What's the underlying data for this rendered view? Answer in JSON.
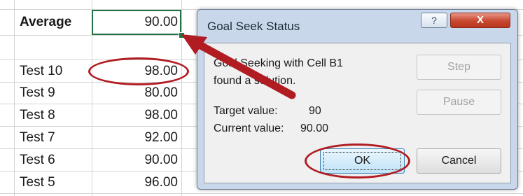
{
  "sheet": {
    "average_row": {
      "label": "Average",
      "value": "90.00"
    },
    "rows": [
      {
        "label": "Test 10",
        "value": "98.00"
      },
      {
        "label": "Test 9",
        "value": "80.00"
      },
      {
        "label": "Test 8",
        "value": "98.00"
      },
      {
        "label": "Test 7",
        "value": "92.00"
      },
      {
        "label": "Test 6",
        "value": "90.00"
      },
      {
        "label": "Test 5",
        "value": "96.00"
      }
    ]
  },
  "dialog": {
    "title": "Goal Seek Status",
    "help_label": "?",
    "close_label": "X",
    "message_line1": "Goal Seeking with Cell B1",
    "message_line2": "found a solution.",
    "target_label": "Target value:",
    "target_value": "90",
    "current_label": "Current value:",
    "current_value": "90.00",
    "step_label": "Step",
    "pause_label": "Pause",
    "ok_label": "OK",
    "cancel_label": "Cancel"
  },
  "colors": {
    "annotation_red": "#b01c22",
    "selection_green": "#217346",
    "dialog_frame": "#c9d7ea"
  }
}
